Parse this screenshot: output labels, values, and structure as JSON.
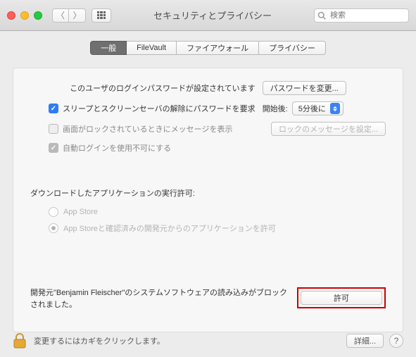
{
  "window": {
    "title": "セキュリティとプライバシー",
    "search_placeholder": "検索"
  },
  "tabs": {
    "general": "一般",
    "filevault": "FileVault",
    "firewall": "ファイアウォール",
    "privacy": "プライバシー"
  },
  "login": {
    "password_set_label": "このユーザのログインパスワードが設定されています",
    "change_password_btn": "パスワードを変更...",
    "require_password_label": "スリープとスクリーンセーバの解除にパスワードを要求",
    "start_after_label": "開始後:",
    "start_after_value": "5分後に",
    "show_message_label": "画面がロックされているときにメッセージを表示",
    "set_lock_message_btn": "ロックのメッセージを設定...",
    "disable_auto_login_label": "自動ログインを使用不可にする"
  },
  "downloads": {
    "heading": "ダウンロードしたアプリケーションの実行許可:",
    "appstore_only": "App Store",
    "appstore_and_identified": "App Storeと確認済みの開発元からのアプリケーションを許可"
  },
  "blocked": {
    "message": "開発元\"Benjamin Fleischer\"のシステムソフトウェアの読み込みがブロックされました。",
    "allow_btn": "許可"
  },
  "footer": {
    "lock_message": "変更するにはカギをクリックします。",
    "details_btn": "詳細..."
  }
}
